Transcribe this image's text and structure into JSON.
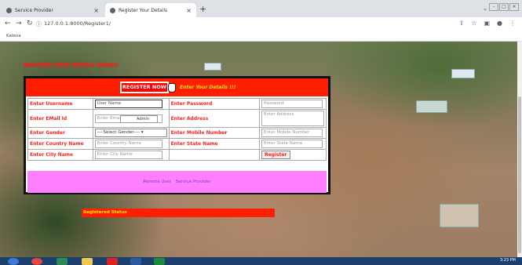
{
  "browser": {
    "tabs": [
      {
        "title": "Service Provider"
      },
      {
        "title": "Register Your Details"
      }
    ],
    "new_tab": "+",
    "url": "127.0.0.1:8000/Register1/",
    "bookmark": "Kalena",
    "tab_close": "×"
  },
  "page": {
    "heading": "REGISTER YOUR DETAILS HERE!!!",
    "register_now": "REGISTER NOW",
    "enter_details": "Enter Your Details !!!",
    "form": {
      "username_label": "Enter Username",
      "username_placeholder": "User Name",
      "password_label": "Enter Password",
      "password_placeholder": "Password",
      "email_label": "Enter EMail Id",
      "email_placeholder": "Enter Email",
      "autocomplete_suggestion": "Admin",
      "address_label": "Enter Address",
      "address_placeholder": "Enter Address",
      "gender_label": "Enter Gender",
      "gender_selected": "----Select Gender----",
      "mobile_label": "Enter Mobile Number",
      "mobile_placeholder": "Enter Mobile Number",
      "country_label": "Enter Country Name",
      "country_placeholder": "Enter Country Name",
      "state_label": "Enter State Name",
      "state_placeholder": "Enter State Name",
      "city_label": "Enter City Name",
      "city_placeholder": "Enter City Name",
      "register_button": "Register"
    },
    "footer_links": [
      "Remote User",
      "Service Provider"
    ],
    "status_label": "Registered Status"
  },
  "taskbar": {
    "time": "3:23 PM"
  }
}
